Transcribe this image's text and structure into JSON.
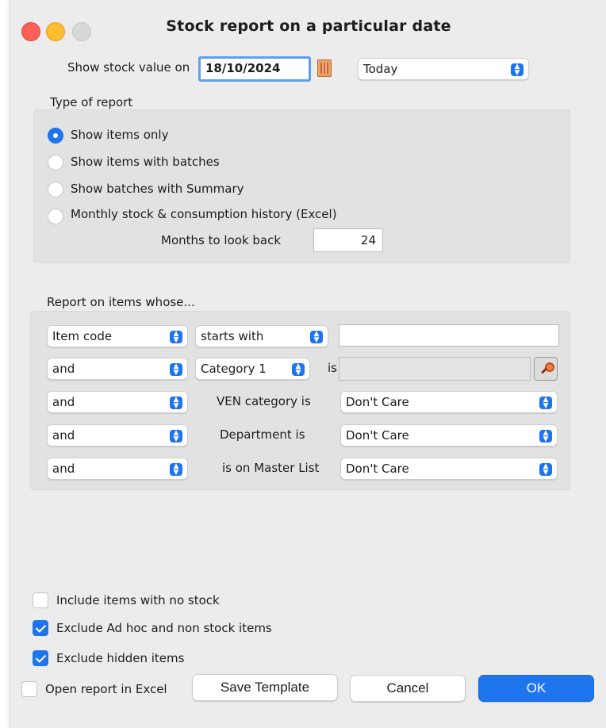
{
  "window": {
    "title": "Stock report on a particular date"
  },
  "date_row": {
    "label": "Show stock value on",
    "date_value": "18/10/2024",
    "date_preset": "Today"
  },
  "report_type": {
    "heading": "Type of report",
    "options": [
      {
        "label": "Show items only",
        "selected": true
      },
      {
        "label": "Show items with batches",
        "selected": false
      },
      {
        "label": "Show batches with Summary",
        "selected": false
      },
      {
        "label": "Monthly stock & consumption history (Excel)",
        "selected": false
      }
    ],
    "months_label": "Months to look back",
    "months_value": "24"
  },
  "filters": {
    "heading": "Report on items whose...",
    "row1": {
      "field": "Item code",
      "operator": "starts with",
      "value": ""
    },
    "row2": {
      "conj": "and",
      "field": "Category 1",
      "is_label": "is",
      "value": ""
    },
    "row3": {
      "conj": "and",
      "label": "VEN category is",
      "value": "Don't Care"
    },
    "row4": {
      "conj": "and",
      "label": "Department is",
      "value": "Don't Care"
    },
    "row5": {
      "conj": "and",
      "label": "is on Master List",
      "value": "Don't Care"
    }
  },
  "options": {
    "include_no_stock": {
      "label": "Include items with no stock",
      "checked": false
    },
    "exclude_adhoc": {
      "label": "Exclude Ad hoc and non stock items",
      "checked": true
    },
    "exclude_hidden": {
      "label": "Exclude hidden items",
      "checked": true
    },
    "open_excel": {
      "label": "Open report in Excel",
      "checked": false
    }
  },
  "buttons": {
    "save_template": "Save Template",
    "cancel": "Cancel",
    "ok": "OK"
  },
  "colors": {
    "accent": "#1f75ee",
    "window_bg": "#ececec",
    "group_bg": "#e2e2e2"
  }
}
